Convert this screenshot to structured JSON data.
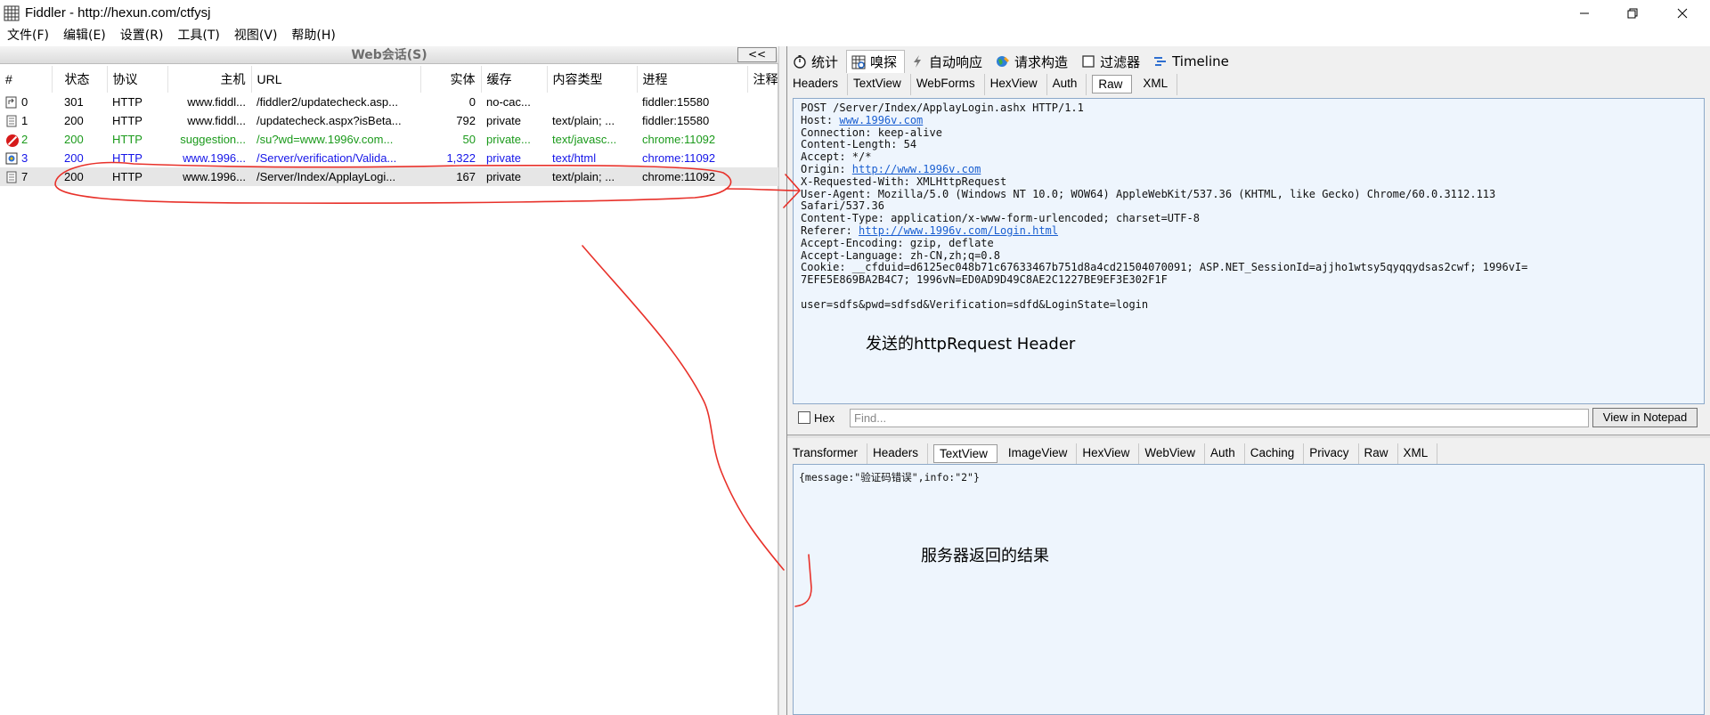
{
  "window": {
    "title": "Fiddler - http://hexun.com/ctfysj"
  },
  "menu": [
    "文件(F)",
    "编辑(E)",
    "设置(R)",
    "工具(T)",
    "视图(V)",
    "帮助(H)"
  ],
  "sessions_panel": {
    "title": "Web会话(S)",
    "collapse_label": "<<",
    "columns": [
      "#",
      "状态",
      "协议",
      "主机",
      "URL",
      "实体",
      "缓存",
      "内容类型",
      "进程",
      "注释"
    ],
    "rows": [
      {
        "num": "0",
        "status": "301",
        "protocol": "HTTP",
        "host": "www.fiddl...",
        "url": "/fiddler2/updatecheck.asp...",
        "body": "0",
        "caching": "no-cac...",
        "content_type": "",
        "process": "fiddler:15580",
        "comments": "",
        "style": "normal",
        "icon": "redirect-icon"
      },
      {
        "num": "1",
        "status": "200",
        "protocol": "HTTP",
        "host": "www.fiddl...",
        "url": "/updatecheck.aspx?isBeta...",
        "body": "792",
        "caching": "private",
        "content_type": "text/plain; ...",
        "process": "fiddler:15580",
        "comments": "",
        "style": "normal",
        "icon": "document-icon"
      },
      {
        "num": "2",
        "status": "200",
        "protocol": "HTTP",
        "host": "suggestion...",
        "url": "/su?wd=www.1996v.com...",
        "body": "50",
        "caching": "private...",
        "content_type": "text/javasc...",
        "process": "chrome:11092",
        "comments": "",
        "style": "green",
        "icon": "blocked-icon"
      },
      {
        "num": "3",
        "status": "200",
        "protocol": "HTTP",
        "host": "www.1996...",
        "url": "/Server/verification/Valida...",
        "body": "1,322",
        "caching": "private",
        "content_type": "text/html",
        "process": "chrome:11092",
        "comments": "",
        "style": "blue",
        "icon": "html-icon"
      },
      {
        "num": "7",
        "status": "200",
        "protocol": "HTTP",
        "host": "www.1996...",
        "url": "/Server/Index/ApplayLogi...",
        "body": "167",
        "caching": "private",
        "content_type": "text/plain; ...",
        "process": "chrome:11092",
        "comments": "",
        "style": "sel",
        "icon": "document-icon"
      }
    ]
  },
  "inspector": {
    "top_tabs": [
      {
        "label": "统计",
        "icon": "stopwatch-icon",
        "active": false
      },
      {
        "label": "嗅探",
        "icon": "inspect-icon",
        "active": true
      },
      {
        "label": "自动响应",
        "icon": "lightning-icon",
        "active": false
      },
      {
        "label": "请求构造",
        "icon": "globe-composer-icon",
        "active": false
      },
      {
        "label": "过滤器",
        "icon": "checkbox-icon",
        "active": false
      },
      {
        "label": "Timeline",
        "icon": "timeline-icon",
        "active": false
      }
    ],
    "request_tabs": [
      {
        "label": "Headers",
        "active": false
      },
      {
        "label": "TextView",
        "active": false
      },
      {
        "label": "WebForms",
        "active": false
      },
      {
        "label": "HexView",
        "active": false
      },
      {
        "label": "Auth",
        "active": false
      },
      {
        "label": "Raw",
        "active": true
      },
      {
        "label": "XML",
        "active": false
      }
    ],
    "request_lines": [
      {
        "text": "POST /Server/Index/ApplayLogin.ashx HTTP/1.1"
      },
      {
        "text": "Host: ",
        "link": "www.1996v.com"
      },
      {
        "text": "Connection: keep-alive"
      },
      {
        "text": "Content-Length: 54"
      },
      {
        "text": "Accept: */*"
      },
      {
        "text": "Origin: ",
        "link": "http://www.1996v.com"
      },
      {
        "text": "X-Requested-With: XMLHttpRequest"
      },
      {
        "text": "User-Agent: Mozilla/5.0 (Windows NT 10.0; WOW64) AppleWebKit/537.36 (KHTML, like Gecko) Chrome/60.0.3112.113"
      },
      {
        "text": "Safari/537.36"
      },
      {
        "text": "Content-Type: application/x-www-form-urlencoded; charset=UTF-8"
      },
      {
        "text": "Referer: ",
        "link": "http://www.1996v.com/Login.html"
      },
      {
        "text": "Accept-Encoding: gzip, deflate"
      },
      {
        "text": "Accept-Language: zh-CN,zh;q=0.8"
      },
      {
        "text": "Cookie: __cfduid=d6125ec048b71c67633467b751d8a4cd21504070091; ASP.NET_SessionId=ajjho1wtsy5qyqqydsas2cwf; 1996vI="
      },
      {
        "text": "7EFE5E869BA2B4C7; 1996vN=ED0AD9D49C8AE2C1227BE9EF3E302F1F"
      },
      {
        "text": ""
      },
      {
        "text": "user=sdfs&pwd=sdfsd&Verification=sdfd&LoginState=login"
      }
    ],
    "find": {
      "hex_label": "Hex",
      "placeholder": "Find...",
      "notepad_label": "View in Notepad"
    },
    "response_tabs": [
      {
        "label": "Transformer",
        "active": false
      },
      {
        "label": "Headers",
        "active": false
      },
      {
        "label": "TextView",
        "active": true
      },
      {
        "label": "ImageView",
        "active": false
      },
      {
        "label": "HexView",
        "active": false
      },
      {
        "label": "WebView",
        "active": false
      },
      {
        "label": "Auth",
        "active": false
      },
      {
        "label": "Caching",
        "active": false
      },
      {
        "label": "Privacy",
        "active": false
      },
      {
        "label": "Raw",
        "active": false
      },
      {
        "label": "XML",
        "active": false
      }
    ],
    "response_body": "{message:\"验证码错误\",info:\"2\"}"
  },
  "annotations": {
    "request_note": "发送的httpRequest Header",
    "response_note": "服务器返回的结果",
    "ink_color": "#e8312a"
  }
}
